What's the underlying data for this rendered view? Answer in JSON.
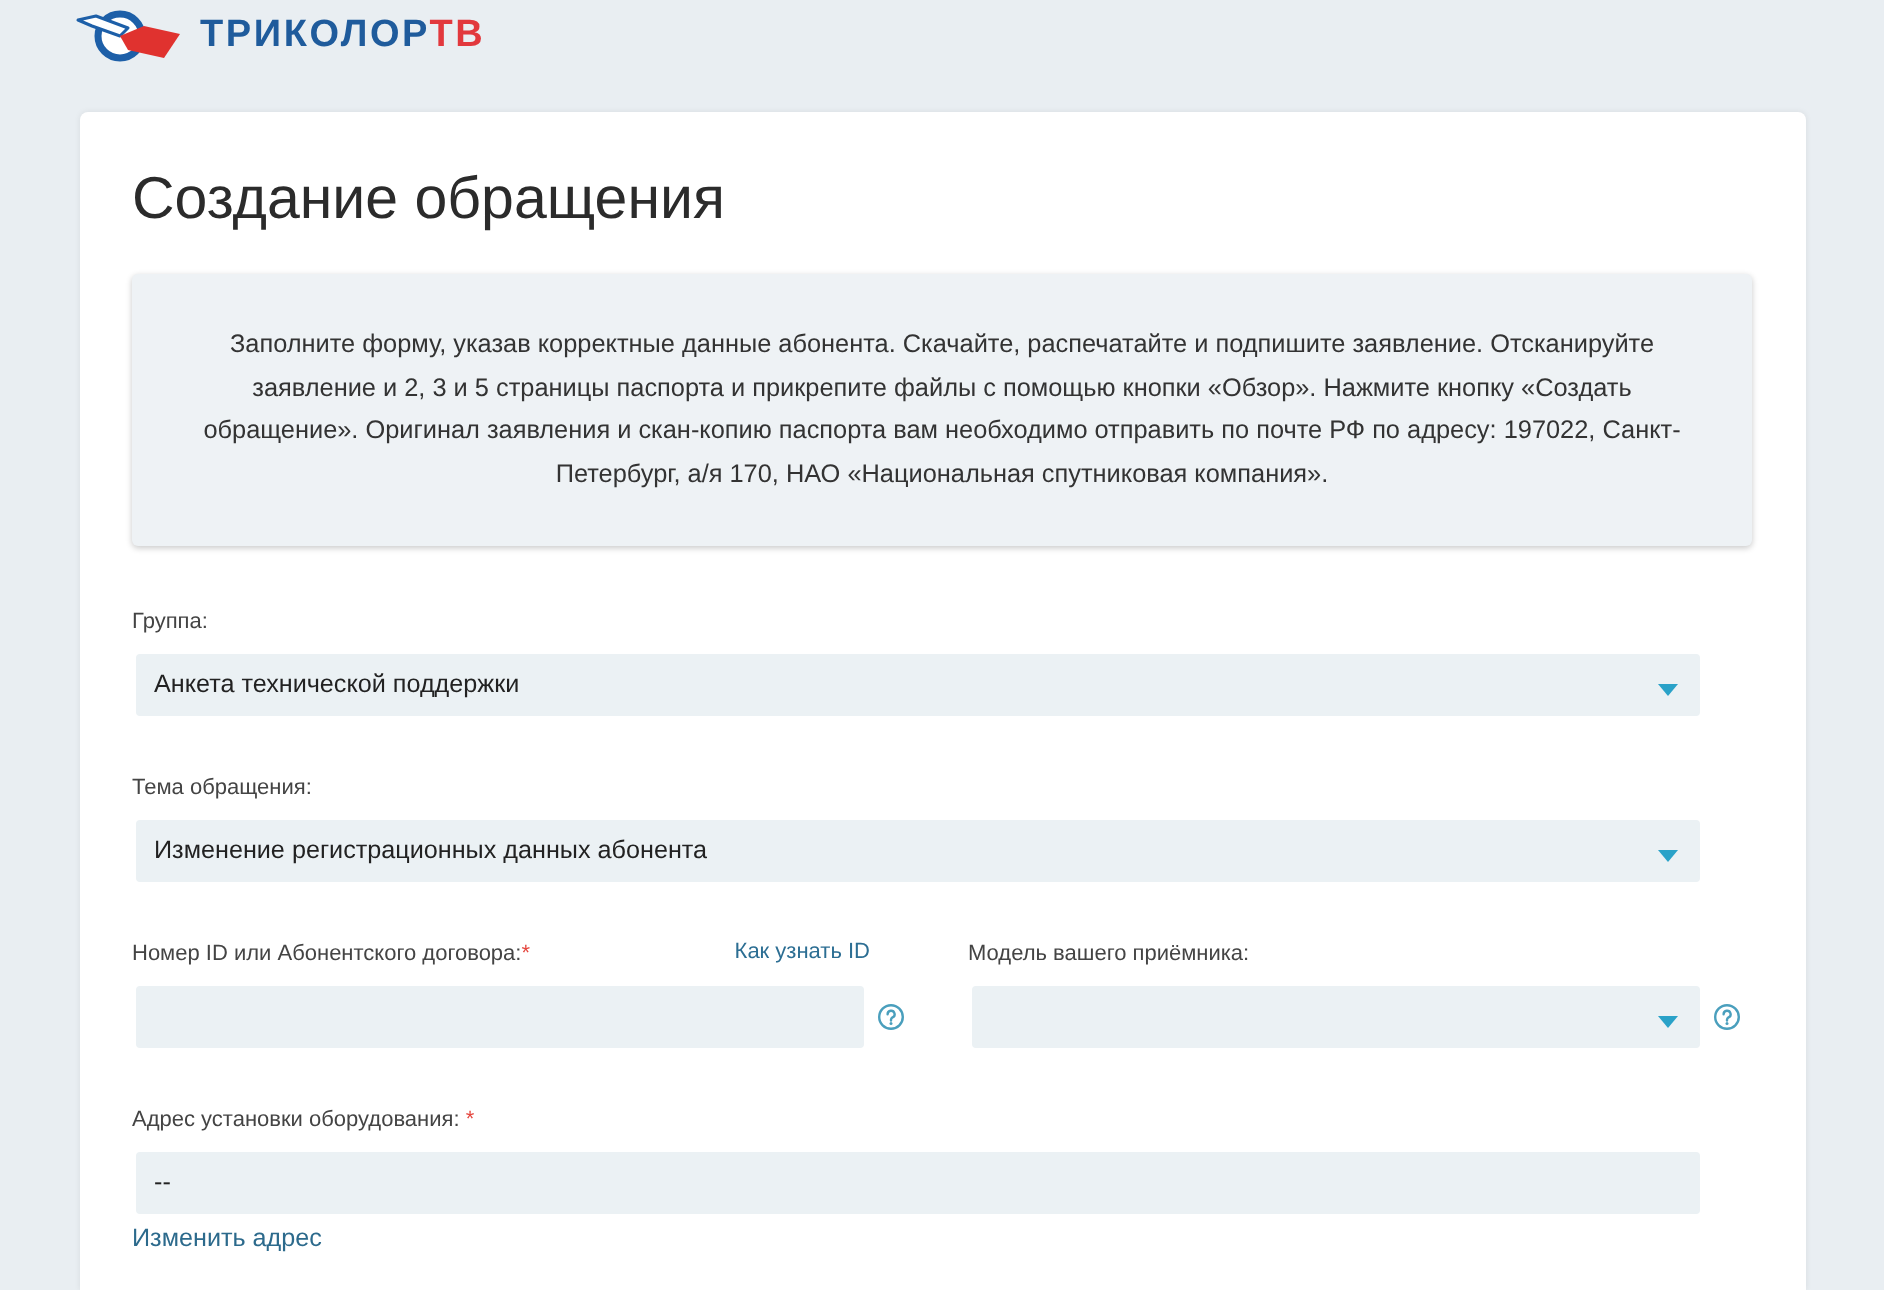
{
  "header": {
    "logo": {
      "name": "ТРИКОЛОР",
      "suffix": "ТВ"
    }
  },
  "form": {
    "title": "Создание обращения",
    "notice": "Заполните форму, указав корректные данные абонента. Скачайте, распечатайте и подпишите заявление. Отсканируйте заявление и 2, 3 и 5 страницы паспорта и прикрепите файлы с помощью кнопки «Обзор». Нажмите кнопку «Создать обращение». Оригинал заявления и скан-копию паспорта вам необходимо отправить по почте РФ по адресу: 197022, Санкт-Петербург, а/я 170, НАО «Национальная спутниковая компания».",
    "rows": [
      {
        "fields": [
          {
            "kind": "select",
            "label": "Группа:",
            "value": "Анкета технической поддержки"
          }
        ]
      },
      {
        "fields": [
          {
            "kind": "select",
            "label": "Тема обращения:",
            "value": "Изменение регистрационных данных абонента"
          }
        ]
      },
      {
        "fields": [
          {
            "kind": "input",
            "label": "Номер ID или Абонентского договора:",
            "required_mark": "*",
            "link": "Как узнать ID",
            "help": true
          },
          {
            "kind": "select",
            "label": "Модель вашего приёмника:",
            "help": true
          }
        ]
      },
      {
        "fields": [
          {
            "kind": "input",
            "label": "Адрес установки оборудования: ",
            "required_mark": "*",
            "value": "--",
            "action_link": "Изменить адрес"
          }
        ]
      }
    ]
  }
}
